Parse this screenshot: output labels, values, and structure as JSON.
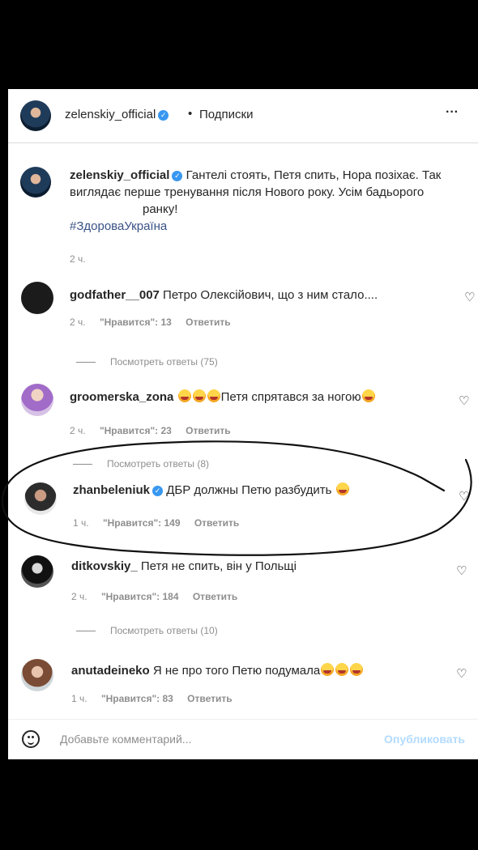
{
  "header": {
    "username": "zelenskiy_official",
    "separator": "•",
    "follow_label": "Подписки",
    "more_label": "···"
  },
  "caption": {
    "username": "zelenskiy_official",
    "text_line1": "Гантелі стоять, Петя спить, Нора позіхає. Так",
    "text_line2": "виглядає перше тренування після Нового року. Усім бадьорого",
    "text_line3": "ранку!",
    "hashtag": "#ЗдороваУкраїна",
    "time": "2 ч."
  },
  "comments": [
    {
      "username": "godfather__007",
      "text": "Петро Олексійович, що з ним стало....",
      "time": "2 ч.",
      "likes": "\"Нравится\": 13",
      "reply": "Ответить",
      "view_replies": "Посмотреть ответы (75)"
    },
    {
      "username": "groomerska_zona",
      "text": "Петя спрятався за ногою",
      "time": "2 ч.",
      "likes": "\"Нравится\": 23",
      "reply": "Ответить",
      "view_replies": "Посмотреть ответы (8)"
    },
    {
      "username": "zhanbeleniuk",
      "text": "ДБР должны Петю разбудить",
      "time": "1 ч.",
      "likes": "\"Нравится\": 149",
      "reply": "Ответить"
    },
    {
      "username": "ditkovskiy_",
      "text": "Петя не спить, він у Польщі",
      "time": "2 ч.",
      "likes": "\"Нравится\": 184",
      "reply": "Ответить",
      "view_replies": "Посмотреть ответы (10)"
    },
    {
      "username": "anutadeineko",
      "text": "Я не про того Петю подумала",
      "time": "1 ч.",
      "likes": "\"Нравится\": 83",
      "reply": "Ответить"
    }
  ],
  "footer": {
    "placeholder": "Добавьте комментарий...",
    "publish_label": "Опубликовать"
  },
  "icons": {
    "verified": "verified-badge-icon",
    "heart": "heart-icon",
    "emoji": "smiley-icon"
  },
  "colors": {
    "link": "#385185",
    "verified": "#3897f0",
    "meta": "#8e8e8e",
    "publish_disabled": "#b3dbff"
  }
}
